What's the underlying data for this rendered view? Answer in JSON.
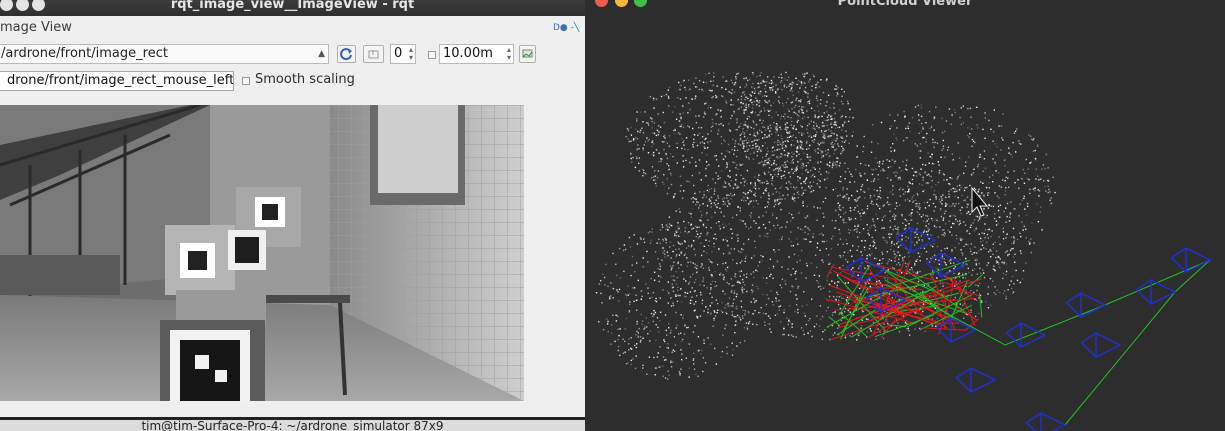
{
  "rqt_window": {
    "title": "rqt_image_view__ImageView - rqt",
    "panel_title": "mage View",
    "panel_controls": "D● -╲",
    "toolbar": {
      "topic_value": "/ardrone/front/image_rect",
      "spin_value": "0",
      "max_range_value": "10.00m"
    },
    "mouse_topic_value": "drone/front/image_rect_mouse_left",
    "smooth_scaling_label": "Smooth scaling"
  },
  "terminal": {
    "title": "tim@tim-Surface-Pro-4: ~/ardrone_simulator 87x9"
  },
  "pointcloud_window": {
    "title": "PointCloud Viewer"
  },
  "colors": {
    "camera_frustum": "#1f2fd6",
    "trajectory": "#22c022",
    "features": "#e01a1a"
  }
}
